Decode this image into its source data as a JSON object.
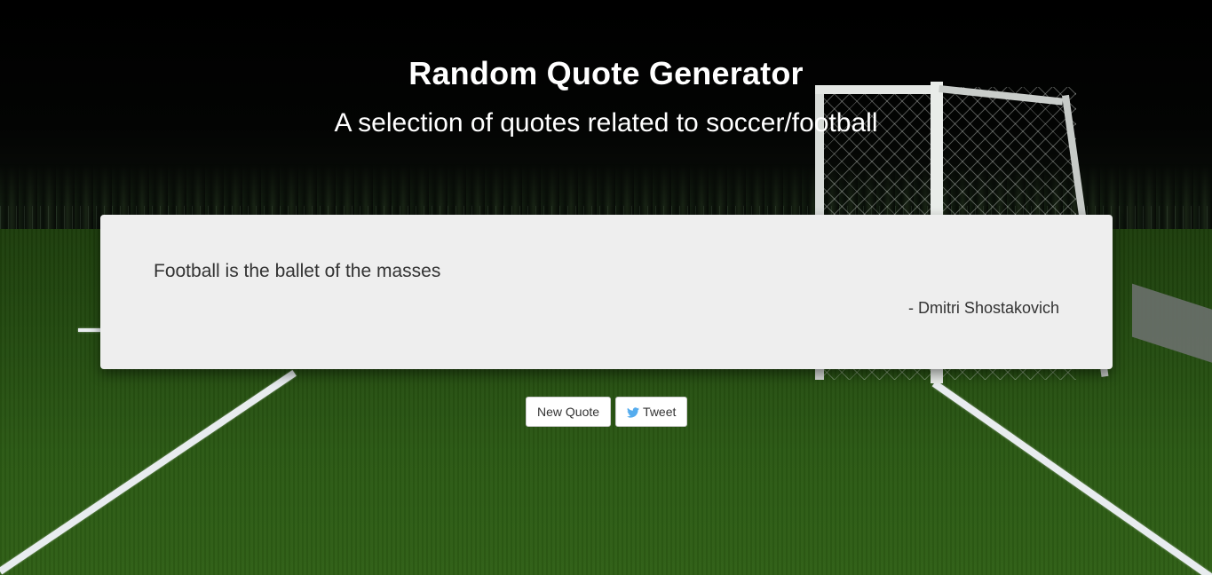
{
  "header": {
    "title": "Random Quote Generator",
    "subtitle": "A selection of quotes related to soccer/football"
  },
  "quote": {
    "text": "Football is the ballet of the masses",
    "author": "- Dmitri Shostakovich"
  },
  "actions": {
    "new_quote_label": "New Quote",
    "tweet_label": "Tweet",
    "tweet_icon": "twitter-bird-icon"
  },
  "colors": {
    "card_background": "#eeeeee",
    "text": "#333333",
    "twitter_blue": "#55acee",
    "heading": "#ffffff"
  }
}
